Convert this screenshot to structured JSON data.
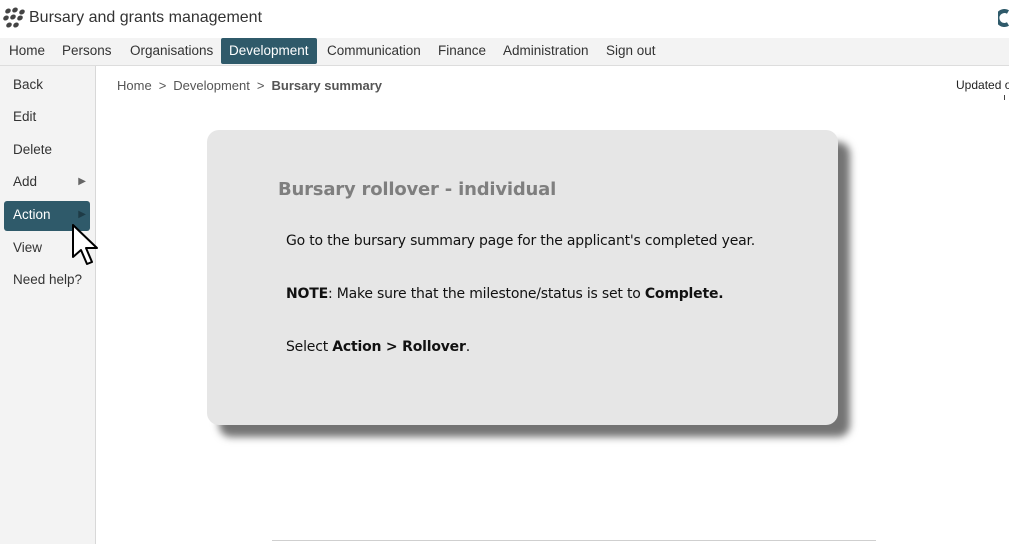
{
  "app": {
    "title": "Bursary and grants management",
    "logo_icon": "cluster-logo-icon",
    "brand_color": "#2f5a6a"
  },
  "topnav": {
    "items": [
      {
        "label": "Home"
      },
      {
        "label": "Persons"
      },
      {
        "label": "Organisations"
      },
      {
        "label": "Development",
        "active": true
      },
      {
        "label": "Communication"
      },
      {
        "label": "Finance"
      },
      {
        "label": "Administration"
      },
      {
        "label": "Sign out"
      }
    ]
  },
  "sidebar": {
    "items": [
      {
        "label": "Back"
      },
      {
        "label": "Edit"
      },
      {
        "label": "Delete"
      },
      {
        "label": "Add",
        "has_submenu": true
      },
      {
        "label": "Action",
        "has_submenu": true,
        "active": true
      },
      {
        "label": "View"
      },
      {
        "label": "Need help?"
      }
    ]
  },
  "breadcrumb": {
    "home": "Home",
    "section": "Development",
    "current": "Bursary summary",
    "separator": ">"
  },
  "updated_text": "Updated on",
  "card": {
    "title": "Bursary rollover - individual",
    "line1": "Go to the bursary summary page for the applicant's completed year.",
    "note_label": "NOTE",
    "note_text": ": Make sure that the milestone/status is set to ",
    "note_status": "Complete.",
    "line3_prefix": "Select ",
    "line3_bold": "Action > Rollover",
    "line3_suffix": "."
  }
}
